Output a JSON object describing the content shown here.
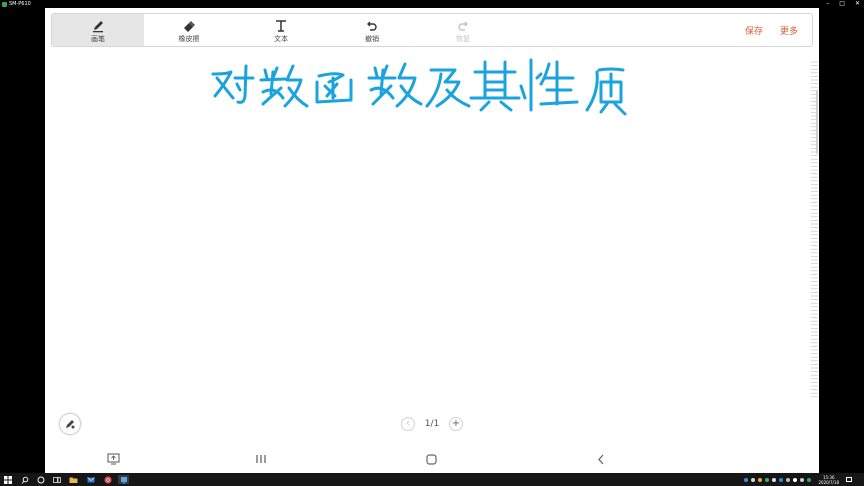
{
  "window": {
    "title": "SM-P610",
    "controls": [
      "–",
      "□",
      "✕"
    ]
  },
  "toolbar": {
    "tools": [
      {
        "label": "画笔",
        "icon": "pen-icon",
        "active": true
      },
      {
        "label": "橡皮擦",
        "icon": "eraser-icon"
      },
      {
        "label": "文本",
        "icon": "text-icon"
      },
      {
        "label": "撤销",
        "icon": "undo-icon"
      },
      {
        "label": "恢复",
        "icon": "redo-icon",
        "disabled": true
      }
    ],
    "save_label": "保存",
    "more_label": "更多"
  },
  "canvas": {
    "handwriting_text": "对数函数及其性质",
    "ink_color": "#1aa3dc"
  },
  "pager": {
    "current": "1/1",
    "prev_symbol": "‹",
    "add_symbol": "+"
  },
  "colors": {
    "accent": "#e05d32",
    "ink": "#1aa3dc"
  },
  "taskbar": {
    "time": "15:36",
    "date": "2020/7/18",
    "apps": [
      "windows-icon",
      "search-icon",
      "cortana-icon",
      "task-view-icon",
      "file-explorer-icon",
      "mail-icon",
      "chrome-icon",
      "screen-mirror-app-icon"
    ]
  }
}
